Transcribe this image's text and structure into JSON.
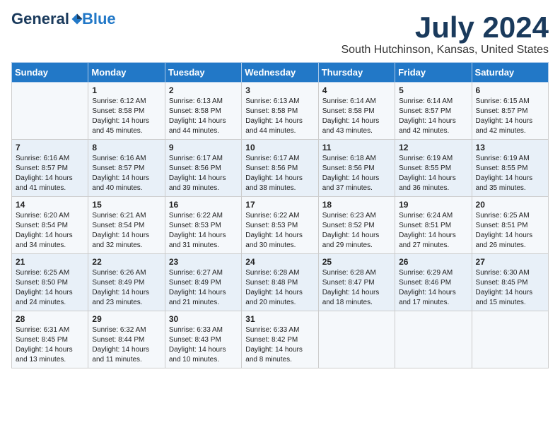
{
  "logo": {
    "general": "General",
    "blue": "Blue"
  },
  "header": {
    "month": "July 2024",
    "location": "South Hutchinson, Kansas, United States"
  },
  "weekdays": [
    "Sunday",
    "Monday",
    "Tuesday",
    "Wednesday",
    "Thursday",
    "Friday",
    "Saturday"
  ],
  "weeks": [
    [
      {
        "day": "",
        "info": ""
      },
      {
        "day": "1",
        "info": "Sunrise: 6:12 AM\nSunset: 8:58 PM\nDaylight: 14 hours\nand 45 minutes."
      },
      {
        "day": "2",
        "info": "Sunrise: 6:13 AM\nSunset: 8:58 PM\nDaylight: 14 hours\nand 44 minutes."
      },
      {
        "day": "3",
        "info": "Sunrise: 6:13 AM\nSunset: 8:58 PM\nDaylight: 14 hours\nand 44 minutes."
      },
      {
        "day": "4",
        "info": "Sunrise: 6:14 AM\nSunset: 8:58 PM\nDaylight: 14 hours\nand 43 minutes."
      },
      {
        "day": "5",
        "info": "Sunrise: 6:14 AM\nSunset: 8:57 PM\nDaylight: 14 hours\nand 42 minutes."
      },
      {
        "day": "6",
        "info": "Sunrise: 6:15 AM\nSunset: 8:57 PM\nDaylight: 14 hours\nand 42 minutes."
      }
    ],
    [
      {
        "day": "7",
        "info": "Sunrise: 6:16 AM\nSunset: 8:57 PM\nDaylight: 14 hours\nand 41 minutes."
      },
      {
        "day": "8",
        "info": "Sunrise: 6:16 AM\nSunset: 8:57 PM\nDaylight: 14 hours\nand 40 minutes."
      },
      {
        "day": "9",
        "info": "Sunrise: 6:17 AM\nSunset: 8:56 PM\nDaylight: 14 hours\nand 39 minutes."
      },
      {
        "day": "10",
        "info": "Sunrise: 6:17 AM\nSunset: 8:56 PM\nDaylight: 14 hours\nand 38 minutes."
      },
      {
        "day": "11",
        "info": "Sunrise: 6:18 AM\nSunset: 8:56 PM\nDaylight: 14 hours\nand 37 minutes."
      },
      {
        "day": "12",
        "info": "Sunrise: 6:19 AM\nSunset: 8:55 PM\nDaylight: 14 hours\nand 36 minutes."
      },
      {
        "day": "13",
        "info": "Sunrise: 6:19 AM\nSunset: 8:55 PM\nDaylight: 14 hours\nand 35 minutes."
      }
    ],
    [
      {
        "day": "14",
        "info": "Sunrise: 6:20 AM\nSunset: 8:54 PM\nDaylight: 14 hours\nand 34 minutes."
      },
      {
        "day": "15",
        "info": "Sunrise: 6:21 AM\nSunset: 8:54 PM\nDaylight: 14 hours\nand 32 minutes."
      },
      {
        "day": "16",
        "info": "Sunrise: 6:22 AM\nSunset: 8:53 PM\nDaylight: 14 hours\nand 31 minutes."
      },
      {
        "day": "17",
        "info": "Sunrise: 6:22 AM\nSunset: 8:53 PM\nDaylight: 14 hours\nand 30 minutes."
      },
      {
        "day": "18",
        "info": "Sunrise: 6:23 AM\nSunset: 8:52 PM\nDaylight: 14 hours\nand 29 minutes."
      },
      {
        "day": "19",
        "info": "Sunrise: 6:24 AM\nSunset: 8:51 PM\nDaylight: 14 hours\nand 27 minutes."
      },
      {
        "day": "20",
        "info": "Sunrise: 6:25 AM\nSunset: 8:51 PM\nDaylight: 14 hours\nand 26 minutes."
      }
    ],
    [
      {
        "day": "21",
        "info": "Sunrise: 6:25 AM\nSunset: 8:50 PM\nDaylight: 14 hours\nand 24 minutes."
      },
      {
        "day": "22",
        "info": "Sunrise: 6:26 AM\nSunset: 8:49 PM\nDaylight: 14 hours\nand 23 minutes."
      },
      {
        "day": "23",
        "info": "Sunrise: 6:27 AM\nSunset: 8:49 PM\nDaylight: 14 hours\nand 21 minutes."
      },
      {
        "day": "24",
        "info": "Sunrise: 6:28 AM\nSunset: 8:48 PM\nDaylight: 14 hours\nand 20 minutes."
      },
      {
        "day": "25",
        "info": "Sunrise: 6:28 AM\nSunset: 8:47 PM\nDaylight: 14 hours\nand 18 minutes."
      },
      {
        "day": "26",
        "info": "Sunrise: 6:29 AM\nSunset: 8:46 PM\nDaylight: 14 hours\nand 17 minutes."
      },
      {
        "day": "27",
        "info": "Sunrise: 6:30 AM\nSunset: 8:45 PM\nDaylight: 14 hours\nand 15 minutes."
      }
    ],
    [
      {
        "day": "28",
        "info": "Sunrise: 6:31 AM\nSunset: 8:45 PM\nDaylight: 14 hours\nand 13 minutes."
      },
      {
        "day": "29",
        "info": "Sunrise: 6:32 AM\nSunset: 8:44 PM\nDaylight: 14 hours\nand 11 minutes."
      },
      {
        "day": "30",
        "info": "Sunrise: 6:33 AM\nSunset: 8:43 PM\nDaylight: 14 hours\nand 10 minutes."
      },
      {
        "day": "31",
        "info": "Sunrise: 6:33 AM\nSunset: 8:42 PM\nDaylight: 14 hours\nand 8 minutes."
      },
      {
        "day": "",
        "info": ""
      },
      {
        "day": "",
        "info": ""
      },
      {
        "day": "",
        "info": ""
      }
    ]
  ]
}
